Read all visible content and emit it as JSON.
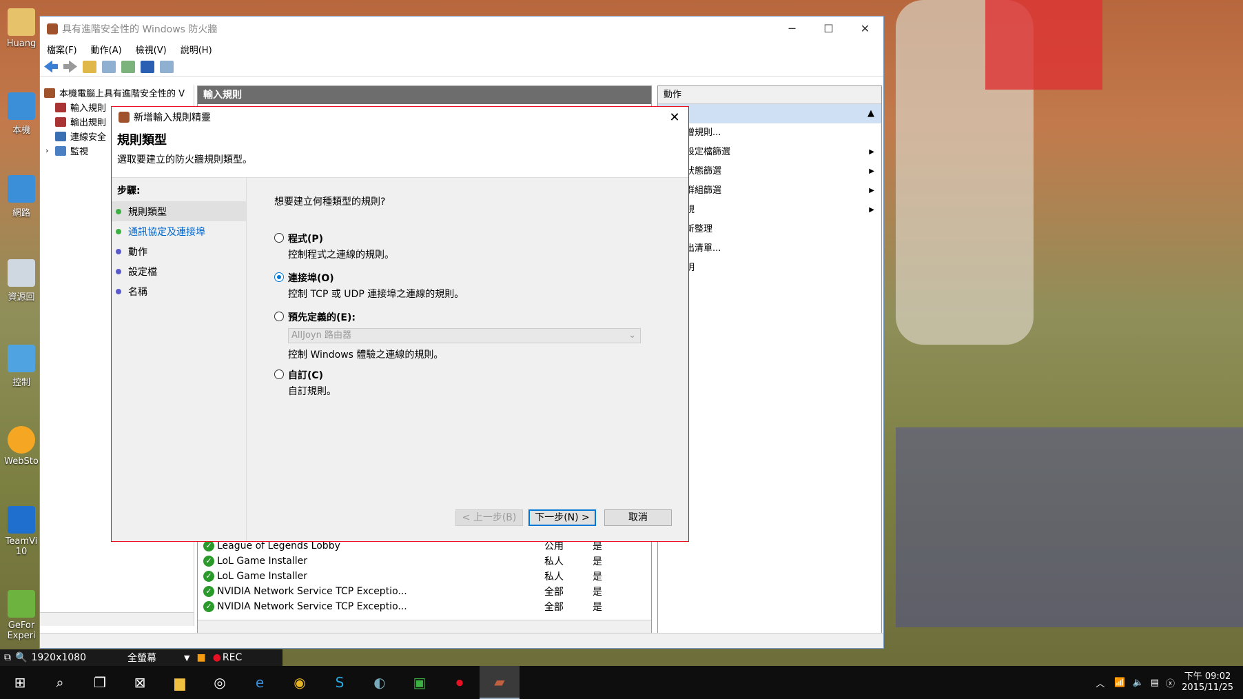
{
  "window": {
    "title": "具有進階安全性的 Windows 防火牆",
    "menu": [
      "檔案(F)",
      "動作(A)",
      "檢視(V)",
      "說明(H)"
    ],
    "tree": [
      "本機電腦上具有進階安全性的 V",
      "輸入規則",
      "輸出規則",
      "連線安全",
      "監視"
    ],
    "middle_header": "輸入規則",
    "rules": [
      {
        "name": "League of Legends Lobby",
        "profile": "公用",
        "enabled": "是"
      },
      {
        "name": "LoL Game Installer",
        "profile": "私人",
        "enabled": "是"
      },
      {
        "name": "LoL Game Installer",
        "profile": "私人",
        "enabled": "是"
      },
      {
        "name": "NVIDIA Network Service TCP Exceptio...",
        "profile": "全部",
        "enabled": "是"
      },
      {
        "name": "NVIDIA Network Service TCP Exceptio...",
        "profile": "全部",
        "enabled": "是"
      }
    ],
    "actions_header": "動作",
    "actions_section": "則",
    "actions": [
      {
        "label": "增規則...",
        "arrow": ""
      },
      {
        "label": "設定檔篩選",
        "arrow": "▶"
      },
      {
        "label": "狀態篩選",
        "arrow": "▶"
      },
      {
        "label": "群組篩選",
        "arrow": "▶"
      },
      {
        "label": "視",
        "arrow": "▶"
      },
      {
        "label": "新整理",
        "arrow": ""
      },
      {
        "label": "出清單...",
        "arrow": ""
      },
      {
        "label": "明",
        "arrow": ""
      }
    ]
  },
  "wizard": {
    "title": "新增輸入規則精靈",
    "heading": "規則類型",
    "subheading": "選取要建立的防火牆規則類型。",
    "steps_title": "步驟:",
    "steps": [
      {
        "label": "規則類型",
        "color": "#3cb043"
      },
      {
        "label": "通訊協定及連接埠",
        "color": "#3cb043"
      },
      {
        "label": "動作",
        "color": "#5a5acb"
      },
      {
        "label": "設定檔",
        "color": "#5a5acb"
      },
      {
        "label": "名稱",
        "color": "#5a5acb"
      }
    ],
    "question": "想要建立何種類型的規則?",
    "options": [
      {
        "label": "程式(P)",
        "desc": "控制程式之連線的規則。"
      },
      {
        "label": "連接埠(O)",
        "desc": "控制 TCP 或 UDP 連接埠之連線的規則。"
      },
      {
        "label": "預先定義的(E):",
        "desc": "控制 Windows 體驗之連線的規則。"
      },
      {
        "label": "自訂(C)",
        "desc": "自訂規則。"
      }
    ],
    "selected_option": "連接埠(O)",
    "predefined_value": "AllJoyn 路由器",
    "buttons": {
      "back": "< 上一步(B)",
      "next": "下一步(N) >",
      "cancel": "取消"
    }
  },
  "desktop_icons": [
    "Huang",
    "本機",
    "網路",
    "資源回",
    "控制",
    "WebSto",
    "TeamVi 10",
    "GeFor Experi"
  ],
  "recorder": {
    "resolution": "1920x1080",
    "mode": "全螢幕",
    "rec": "REC"
  },
  "taskbar": {
    "time": "下午 09:02",
    "date": "2015/11/25"
  }
}
